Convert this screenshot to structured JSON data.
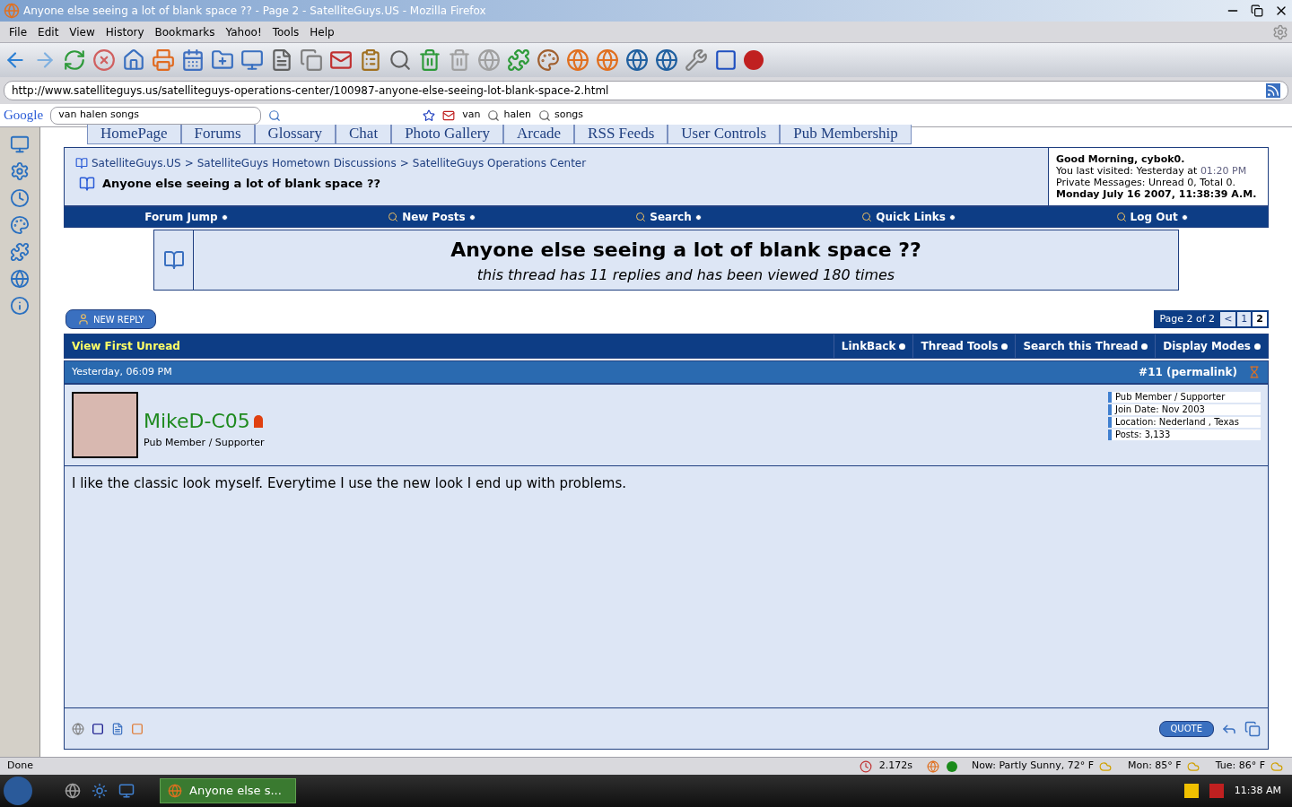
{
  "window": {
    "title": "Anyone else seeing a lot of blank space ?? - Page 2 - SatelliteGuys.US - Mozilla Firefox"
  },
  "menu": [
    "File",
    "Edit",
    "View",
    "History",
    "Bookmarks",
    "Yahoo!",
    "Tools",
    "Help"
  ],
  "address": "http://www.satelliteguys.us/satelliteguys-operations-center/100987-anyone-else-seeing-lot-blank-space-2.html",
  "google": {
    "logo": "Google",
    "query": "van halen songs",
    "terms": [
      "van",
      "halen",
      "songs"
    ]
  },
  "site_tabs": [
    "HomePage",
    "Forums",
    "Glossary",
    "Chat",
    "Photo Gallery",
    "Arcade",
    "RSS Feeds",
    "User Controls",
    "Pub Membership"
  ],
  "breadcrumb": [
    "SatelliteGuys.US",
    "SatelliteGuys Hometown Discussions",
    "SatelliteGuys Operations Center"
  ],
  "breadcrumb_separator": ">",
  "current_thread": "Anyone else seeing a lot of blank space ??",
  "welcome": {
    "greeting": "Good Morning, cybok0.",
    "last_visit_label": "You last visited: Yesterday at",
    "last_visit_time": "01:20 PM",
    "private_messages": "Private Messages: Unread 0, Total 0.",
    "date": "Monday July 16 2007, 11:38:39 A.M."
  },
  "navbar": [
    {
      "label": "Forum Jump",
      "kind": "plain"
    },
    {
      "label": "New Posts",
      "kind": "icon"
    },
    {
      "label": "Search",
      "kind": "icon"
    },
    {
      "label": "Quick Links",
      "kind": "icon"
    },
    {
      "label": "Log Out",
      "kind": "icon"
    }
  ],
  "thread": {
    "title": "Anyone else seeing a lot of blank space ??",
    "subtitle": "this thread has 11 replies and has been viewed 180 times"
  },
  "new_reply": "NEW REPLY",
  "pagination": {
    "label": "Page 2 of 2",
    "prev": "<",
    "pages": [
      {
        "label": "1",
        "selected": false
      },
      {
        "label": "2",
        "selected": true
      }
    ]
  },
  "thread_bar": {
    "first_unread": "View First Unread",
    "tools": [
      "LinkBack",
      "Thread Tools",
      "Search this Thread",
      "Display Modes"
    ]
  },
  "post": {
    "date": "Yesterday, 06:09 PM",
    "number": "#11 (permalink)",
    "user": "MikeD-C05",
    "user_title": "Pub Member / Supporter",
    "online": true,
    "info": [
      "Pub Member / Supporter",
      "Join Date: Nov 2003",
      "Location: Nederland , Texas",
      "Posts: 3,133"
    ],
    "message": "I like the classic look myself. Everytime I use the new look I end up with problems.",
    "quote": "QUOTE"
  },
  "status_bar": {
    "text": "Done",
    "timing": "2.172s",
    "weather": [
      "Now: Partly Sunny, 72° F",
      "Mon: 85° F",
      "Tue: 86° F"
    ]
  },
  "taskbar": {
    "task": "Anyone else s...",
    "clock": "11:38 AM"
  }
}
